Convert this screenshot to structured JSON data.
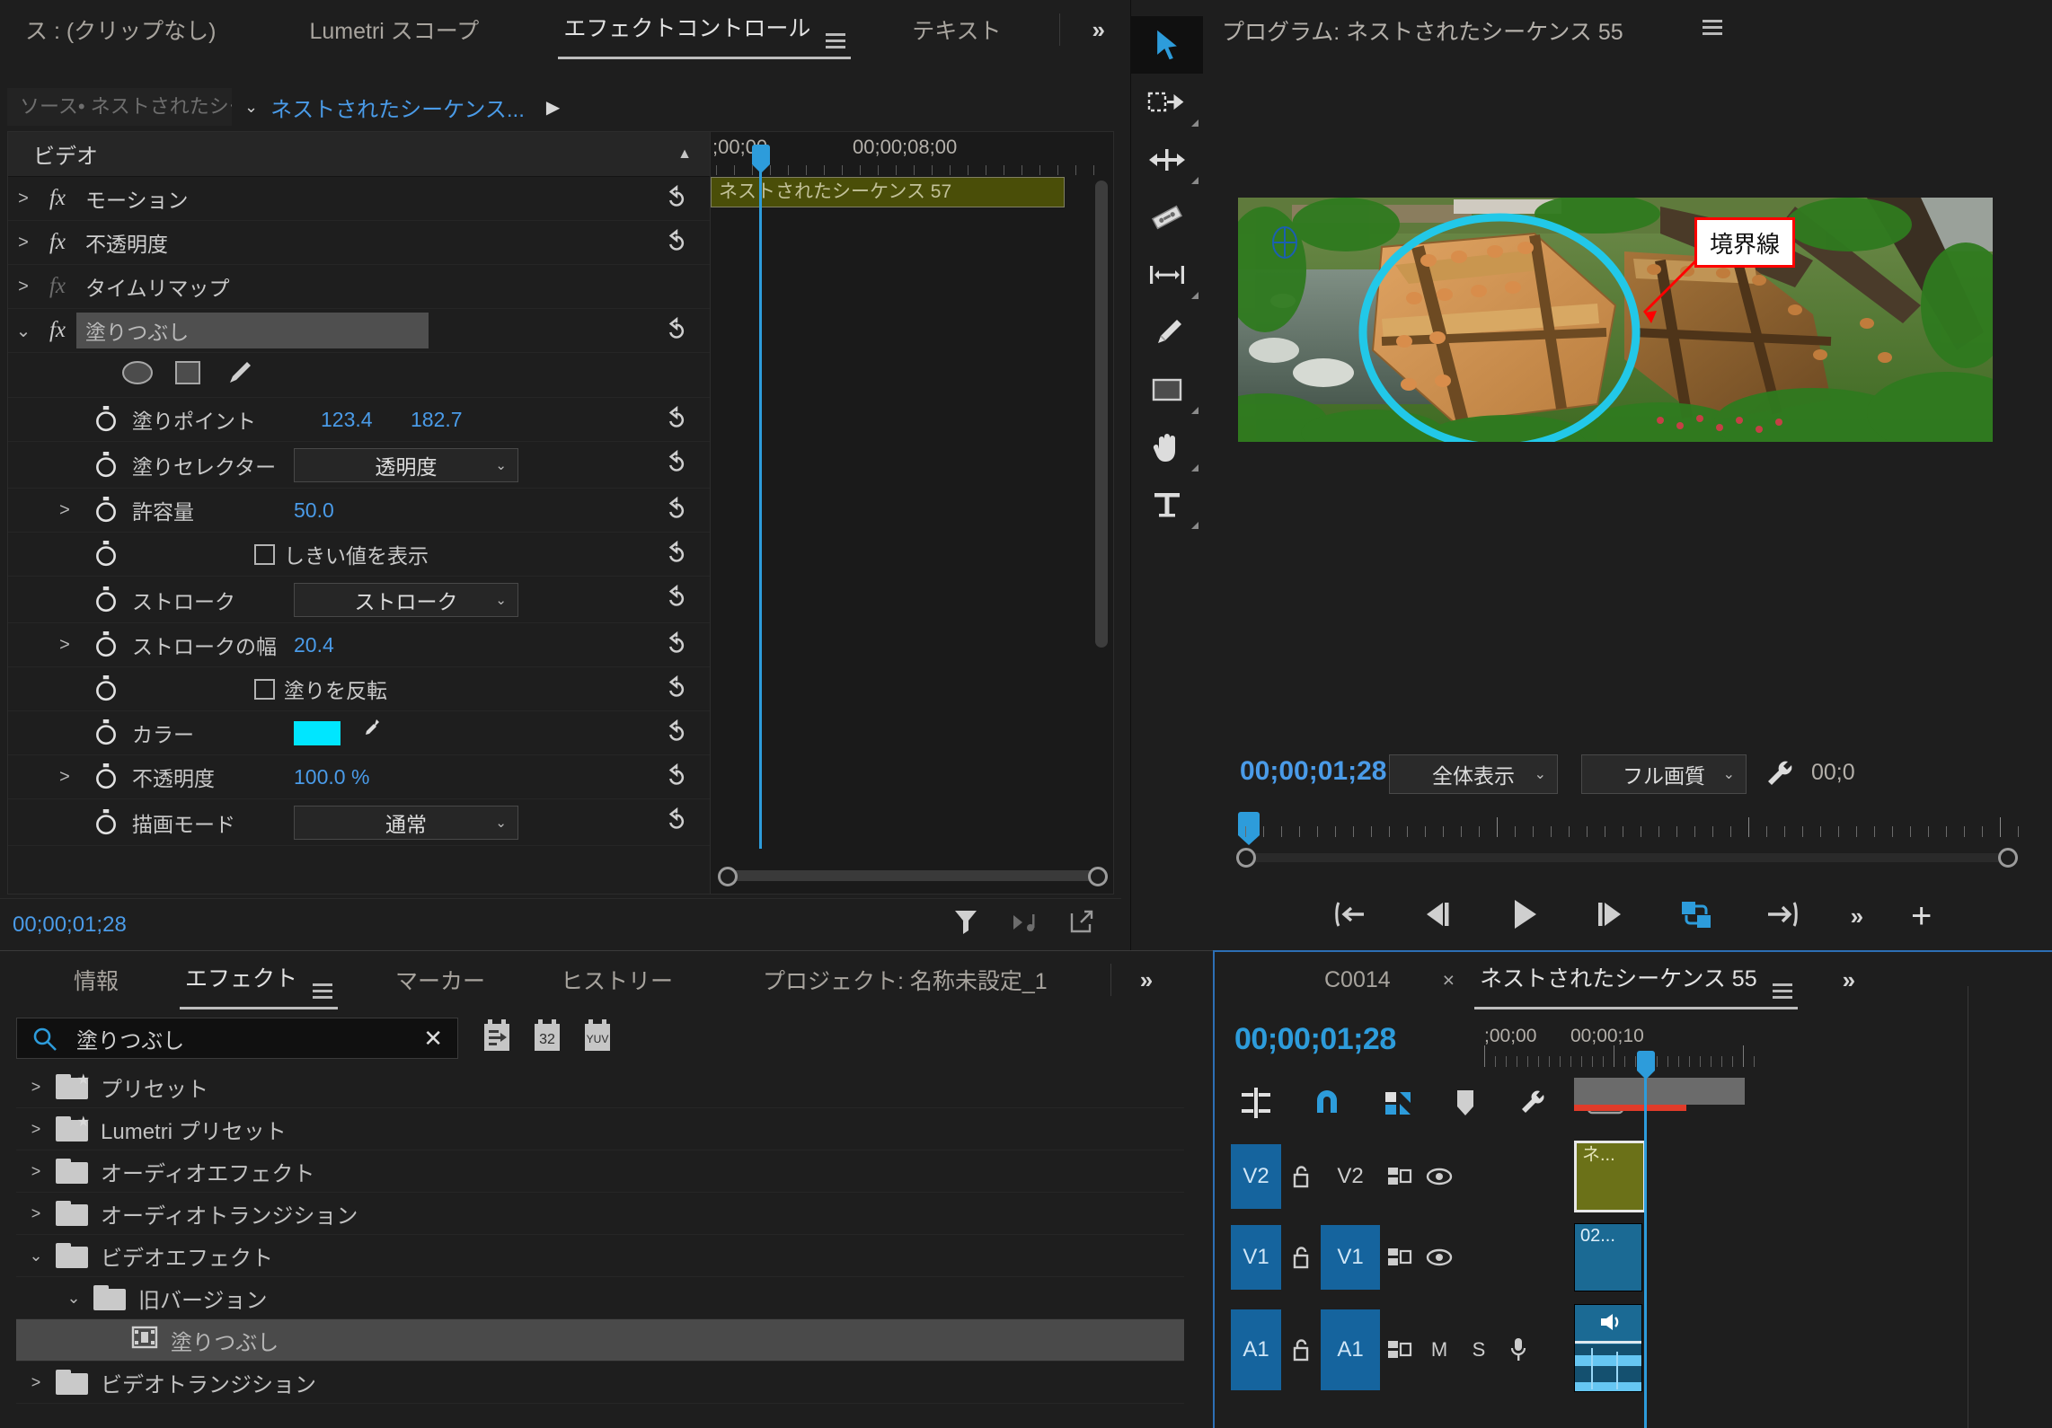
{
  "effect_controls": {
    "tabs": [
      {
        "label": "ス : (クリップなし)",
        "active": false
      },
      {
        "label": "Lumetri スコープ",
        "active": false
      },
      {
        "label": "エフェクトコントロール",
        "active": true
      },
      {
        "label": "テキスト",
        "active": false
      }
    ],
    "overflow_label": "»",
    "source_label": "ソース• ネストされたシー...",
    "sequence_label": "ネストされたシーケンス...",
    "section_header": "ビデオ",
    "fx_items": [
      {
        "name": "モーション",
        "expanded": false,
        "enabled": true
      },
      {
        "name": "不透明度",
        "expanded": false,
        "enabled": true
      },
      {
        "name": "タイムリマップ",
        "expanded": false,
        "enabled": false
      },
      {
        "name": "塗りつぶし",
        "expanded": true,
        "enabled": true,
        "selected": true
      }
    ],
    "params": [
      {
        "name": "塗りポイント",
        "value1": "123.4",
        "value2": "182.7",
        "kind": "point"
      },
      {
        "name": "塗りセレクター",
        "value": "透明度",
        "kind": "dropdown"
      },
      {
        "name": "許容量",
        "value": "50.0",
        "kind": "number",
        "twirl": true
      },
      {
        "name": "",
        "value": "しきい値を表示",
        "kind": "checkbox",
        "checked": false
      },
      {
        "name": "ストローク",
        "value": "ストローク",
        "kind": "dropdown"
      },
      {
        "name": "ストロークの幅",
        "value": "20.4",
        "kind": "number",
        "twirl": true
      },
      {
        "name": "",
        "value": "塗りを反転",
        "kind": "checkbox",
        "checked": false
      },
      {
        "name": "カラー",
        "value": "#00E6FF",
        "kind": "color"
      },
      {
        "name": "不透明度",
        "value": "100.0 %",
        "kind": "number",
        "twirl": true
      },
      {
        "name": "描画モード",
        "value": "通常",
        "kind": "dropdown"
      }
    ],
    "shape_tools": [
      "ellipse-mask-icon",
      "rectangle-mask-icon",
      "pen-mask-icon"
    ],
    "timeline": {
      "time_start_label": ";00;00",
      "time_end_label": "00;00;08;00",
      "clip_label": "ネストされたシーケンス 57",
      "clip_color": "#4a4e08"
    },
    "footer_timecode": "00;00;01;28",
    "footer_icons": [
      "filter-icon",
      "audio-keyframe-icon",
      "export-icon"
    ]
  },
  "tools": [
    {
      "name": "selection-tool",
      "glyph": "cursor",
      "active": true
    },
    {
      "name": "track-select-forward-tool",
      "glyph": "track-select",
      "active": false
    },
    {
      "name": "ripple-edit-tool",
      "glyph": "ripple",
      "active": false
    },
    {
      "name": "razor-tool",
      "glyph": "razor",
      "active": false
    },
    {
      "name": "slip-tool",
      "glyph": "slip",
      "active": false
    },
    {
      "name": "pen-tool",
      "glyph": "pen",
      "active": false
    },
    {
      "name": "rectangle-tool",
      "glyph": "rect",
      "active": false
    },
    {
      "name": "hand-tool",
      "glyph": "hand",
      "active": false
    },
    {
      "name": "type-tool",
      "glyph": "type",
      "active": false
    }
  ],
  "program_monitor": {
    "title": "プログラム: ネストされたシーケンス 55",
    "timecode": "00;00;01;28",
    "fit_select": "全体表示",
    "quality_select": "フル画質",
    "duration_partial": "00;0",
    "annotation_label": "境界線",
    "annotation_box_color": "#ff0000",
    "mask_color": "#22c8e8",
    "transport_buttons": [
      "mark-in-out-icon",
      "step-back-icon",
      "play-icon",
      "step-forward-icon",
      "lift-extract-icon",
      "export-frame-icon",
      "more-icon",
      "plus-icon"
    ],
    "wrench_icon": "settings-wrench-icon"
  },
  "effects_panel": {
    "tabs": [
      {
        "label": "情報",
        "active": false
      },
      {
        "label": "エフェクト",
        "active": true
      },
      {
        "label": "マーカー",
        "active": false
      },
      {
        "label": "ヒストリー",
        "active": false
      },
      {
        "label": "プロジェクト: 名称未設定_1",
        "active": false
      }
    ],
    "overflow_label": "»",
    "search_value": "塗りつぶし",
    "search_clear": "✕",
    "filter_badges": [
      "accelerated-icon",
      "32",
      "YUV"
    ],
    "tree": [
      {
        "label": "プリセット",
        "depth": 0,
        "state": "collapsed",
        "icon": "preset-folder-icon"
      },
      {
        "label": "Lumetri プリセット",
        "depth": 0,
        "state": "collapsed",
        "icon": "preset-folder-icon"
      },
      {
        "label": "オーディオエフェクト",
        "depth": 0,
        "state": "collapsed",
        "icon": "folder-icon"
      },
      {
        "label": "オーディオトランジション",
        "depth": 0,
        "state": "collapsed",
        "icon": "folder-icon"
      },
      {
        "label": "ビデオエフェクト",
        "depth": 0,
        "state": "expanded",
        "icon": "folder-icon"
      },
      {
        "label": "旧バージョン",
        "depth": 1,
        "state": "expanded",
        "icon": "folder-icon"
      },
      {
        "label": "塗りつぶし",
        "depth": 2,
        "state": "leaf",
        "icon": "effect-icon",
        "selected": true
      },
      {
        "label": "ビデオトランジション",
        "depth": 0,
        "state": "collapsed",
        "icon": "folder-icon"
      }
    ]
  },
  "timeline_panel": {
    "tabs": [
      {
        "label": "C0014",
        "active": false
      },
      {
        "label": "ネストされたシーケンス 55",
        "active": true
      }
    ],
    "close_label": "×",
    "overflow_label": "»",
    "timecode": "00;00;01;28",
    "ruler_labels": [
      ";00;00",
      "00;00;10"
    ],
    "toolbar_icons": [
      "insert-overwrite-icon",
      "snap-icon",
      "linked-selection-icon",
      "marker-icon",
      "wrench-icon",
      "closed-captions-icon"
    ],
    "tracks": [
      {
        "name": "V2",
        "type": "video",
        "controls": [
          "lock-icon",
          "sync-lock-icon",
          "eye-icon"
        ],
        "clip": {
          "label": "ネ...",
          "color": "#6b7118",
          "selected": true
        }
      },
      {
        "name": "V1",
        "type": "video",
        "controls": [
          "lock-icon",
          "sync-lock-icon",
          "eye-icon"
        ],
        "clip": {
          "label": "02...",
          "color": "#1b6a94",
          "selected": false
        }
      },
      {
        "name": "A1",
        "type": "audio",
        "controls": [
          "lock-icon",
          "sync-lock-icon",
          "M",
          "S",
          "mic-icon"
        ],
        "clip": {
          "label": "",
          "color": "#1b6a94",
          "selected": false
        }
      }
    ],
    "track_mute_label": "M",
    "track_solo_label": "S"
  }
}
